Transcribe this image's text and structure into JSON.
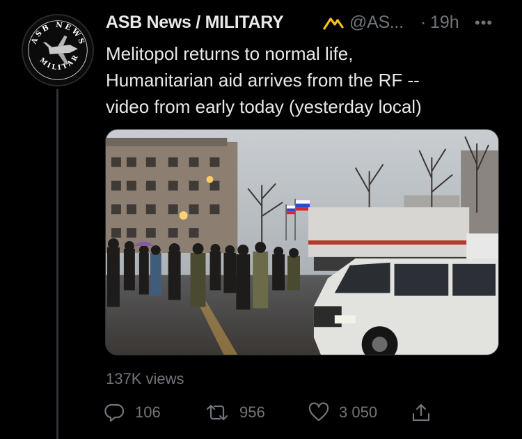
{
  "tweet": {
    "author_name": "ASB News / MILITARY",
    "handle": "@AS...",
    "separator": "·",
    "timestamp": "19h",
    "more_label": "•••",
    "text_lines": [
      "Melitopol returns to normal life,",
      "Humanitarian aid arrives from the RF --",
      "video from early today (yesterday local)"
    ],
    "views": "137K views",
    "avatar_text": "ASB NEWS MILITARY"
  },
  "actions": {
    "reply_count": "106",
    "retweet_count": "956",
    "like_count": "3 050"
  },
  "icons": {
    "verified": "verified-badge-icon",
    "reply": "reply-icon",
    "retweet": "retweet-icon",
    "like": "heart-icon",
    "share": "share-icon"
  },
  "colors": {
    "background": "#000000",
    "text": "#e7e9ea",
    "muted": "#71767b",
    "badge": "#f5c518"
  }
}
